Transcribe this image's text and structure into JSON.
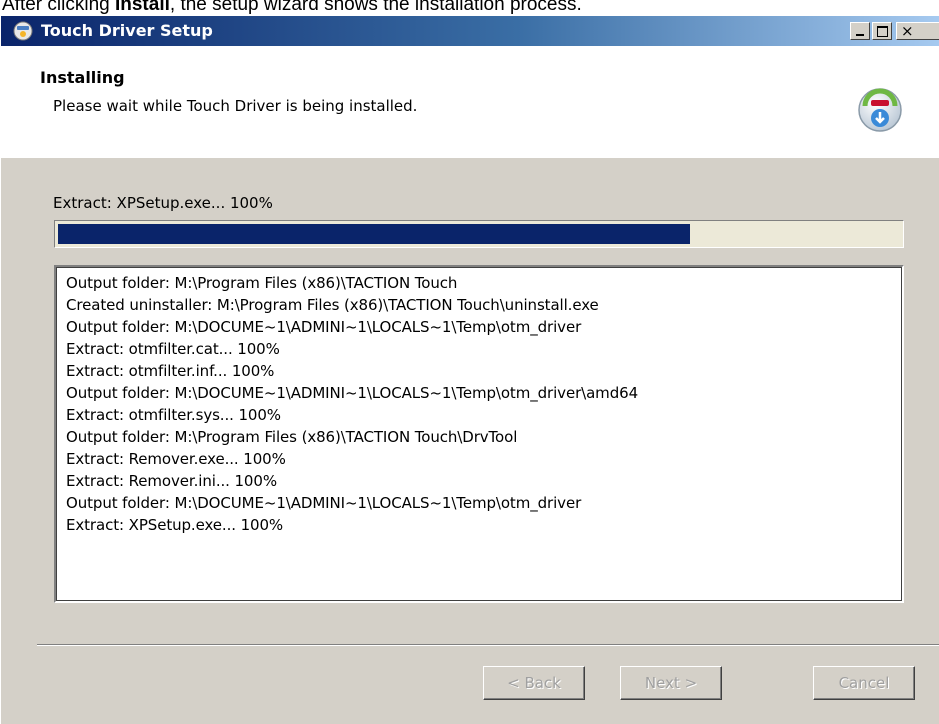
{
  "caption": {
    "before": "After clicking ",
    "bold": "Install",
    "after": ", the setup wizard shows the installation process."
  },
  "window": {
    "title": "Touch Driver Setup",
    "controls": {
      "minimize": "_",
      "maximize": "□",
      "close": "×"
    }
  },
  "header": {
    "title": "Installing",
    "subtitle": "Please wait while Touch Driver is being installed.",
    "icon": "installer-disc-icon"
  },
  "status": {
    "text": "Extract: XPSetup.exe... 100%",
    "progress": 0.75
  },
  "log": [
    "Output folder: M:\\Program Files (x86)\\TACTION Touch",
    "Created uninstaller: M:\\Program Files (x86)\\TACTION Touch\\uninstall.exe",
    "Output folder: M:\\DOCUME~1\\ADMINI~1\\LOCALS~1\\Temp\\otm_driver",
    "Extract: otmfilter.cat... 100%",
    "Extract: otmfilter.inf... 100%",
    "Output folder: M:\\DOCUME~1\\ADMINI~1\\LOCALS~1\\Temp\\otm_driver\\amd64",
    "Extract: otmfilter.sys... 100%",
    "Output folder: M:\\Program Files (x86)\\TACTION Touch\\DrvTool",
    "Extract: Remover.exe... 100%",
    "Extract: Remover.ini... 100%",
    "Output folder: M:\\DOCUME~1\\ADMINI~1\\LOCALS~1\\Temp\\otm_driver",
    "Extract: XPSetup.exe... 100%"
  ],
  "buttons": {
    "back": "< Back",
    "next": "Next >",
    "cancel": "Cancel"
  },
  "colors": {
    "progress_fill": "#0a246a",
    "titlebar_start": "#0a246a",
    "titlebar_end": "#a6caf0",
    "face": "#d4d0c8"
  }
}
